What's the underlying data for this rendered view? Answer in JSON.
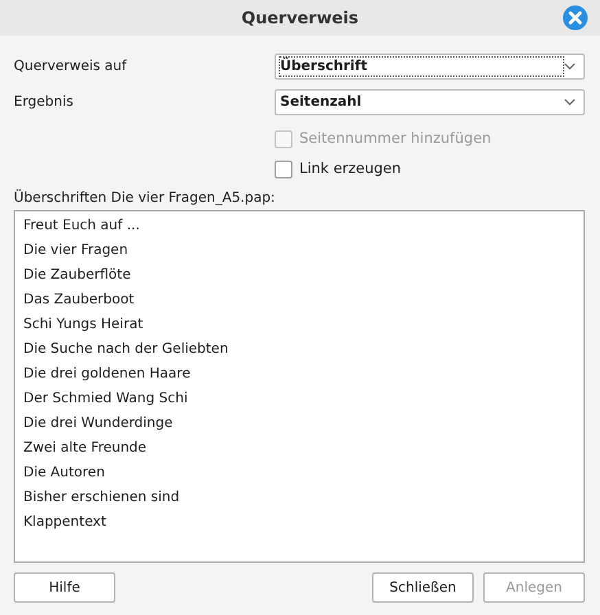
{
  "window": {
    "title": "Querverweis"
  },
  "fields": [
    {
      "label": "Querverweis auf",
      "value": "Überschrift",
      "focused": true
    },
    {
      "label": "Ergebnis",
      "value": "Seitenzahl",
      "focused": false
    }
  ],
  "options": [
    {
      "label": "Seitennummer hinzufügen",
      "checked": false,
      "disabled": true
    },
    {
      "label": "Link erzeugen",
      "checked": false,
      "disabled": false
    }
  ],
  "list": {
    "heading": "Überschriften Die vier Fragen_A5.pap:",
    "items": [
      {
        "label": "Freut Euch auf ..."
      },
      {
        "label": "Die vier Fragen"
      },
      {
        "label": "Die Zauberflöte"
      },
      {
        "label": "Das Zauberboot"
      },
      {
        "label": "Schi Yungs Heirat"
      },
      {
        "label": "Die Suche nach der Geliebten"
      },
      {
        "label": "Die drei goldenen Haare"
      },
      {
        "label": "Der Schmied Wang Schi"
      },
      {
        "label": "Die drei Wunderdinge"
      },
      {
        "label": "Zwei alte Freunde"
      },
      {
        "label": "Die Autoren"
      },
      {
        "label": "Bisher erschienen sind"
      },
      {
        "label": "Klappentext"
      }
    ]
  },
  "buttons": [
    {
      "label": "Hilfe",
      "disabled": false,
      "kind": "help"
    },
    {
      "label": "Schließen",
      "disabled": false,
      "kind": "action"
    },
    {
      "label": "Anlegen",
      "disabled": true,
      "kind": "action"
    }
  ]
}
